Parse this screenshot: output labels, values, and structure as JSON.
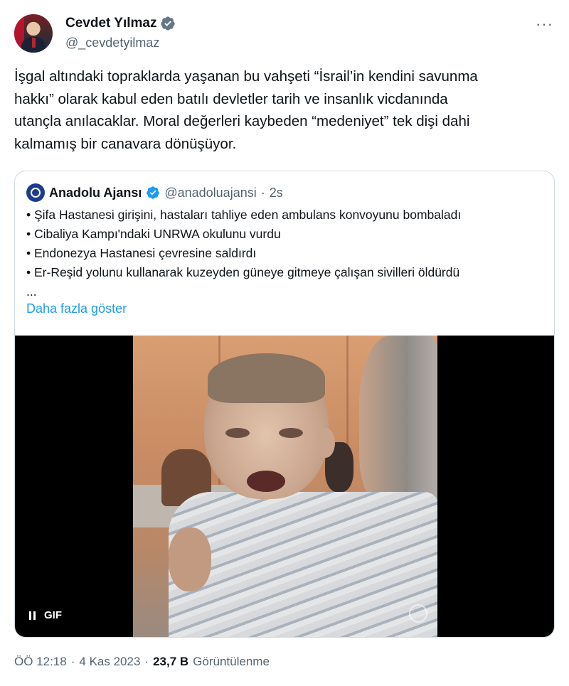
{
  "author": {
    "display_name": "Cevdet Yılmaz",
    "handle": "@_cevdetyilmaz",
    "verified": true,
    "more_label": "···"
  },
  "tweet": {
    "text": "İşgal altındaki topraklarda yaşanan bu vahşeti “İsrail’in kendini savunma\nhakkı” olarak kabul eden batılı devletler tarih ve insanlık vicdanında\nutançla anılacaklar. Moral değerleri kaybeden “medeniyet” tek dişi dahi\nkalmamış bir canavara dönüşüyor."
  },
  "quote": {
    "name": "Anadolu Ajansı",
    "handle": "@anadoluajansi",
    "separator": "·",
    "time": "2s",
    "lines": [
      "• Şifa Hastanesi girişini, hastaları tahliye eden ambulans konvoyunu bombaladı",
      "• Cibaliya Kampı'ndaki UNRWA okulunu vurdu",
      "• Endonezya Hastanesi çevresine saldırdı",
      "• Er-Reşid yolunu kullanarak kuzeyden güneye gitmeye çalışan sivilleri öldürdü",
      "..."
    ],
    "show_more": "Daha fazla göster",
    "media": {
      "badge": "GIF",
      "watermark": "AA"
    }
  },
  "meta": {
    "time": "ÖÖ 12:18",
    "dot1": "·",
    "date": "4 Kas 2023",
    "dot2": "·",
    "views_count": "23,7 B",
    "views_label": "Görüntülenme"
  },
  "colors": {
    "accent": "#1d9bf0",
    "secondary_text": "#536471",
    "border": "#cfd9de"
  }
}
